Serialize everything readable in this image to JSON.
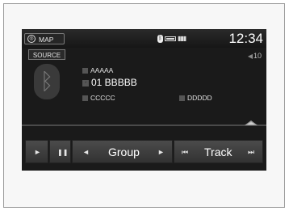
{
  "header": {
    "map_label": "MAP",
    "clock": "12:34"
  },
  "source_label": "SOURCE",
  "volume": "10",
  "now_playing": {
    "artist": "AAAAA",
    "track": "01 BBBBB",
    "album": "CCCCC",
    "genre": "DDDDD"
  },
  "controls": {
    "group_label": "Group",
    "track_label": "Track"
  },
  "icons": {
    "bluetooth": "bluetooth-icon",
    "play": "play-icon",
    "pause": "pause-icon",
    "prev_group": "left-triangle-icon",
    "next_group": "right-triangle-icon",
    "prev_track": "skip-back-icon",
    "next_track": "skip-forward-icon"
  }
}
